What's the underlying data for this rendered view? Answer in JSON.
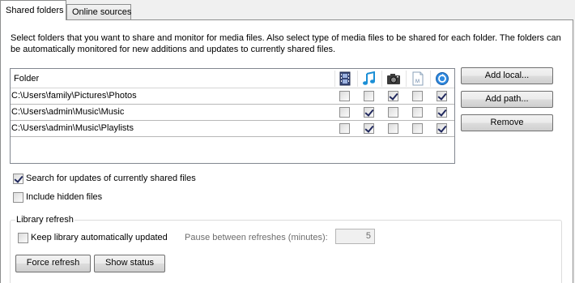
{
  "tabs": [
    {
      "label": "Shared folders",
      "active": true
    },
    {
      "label": "Online sources",
      "active": false
    }
  ],
  "description": "Select folders that you want to share and monitor for media files. Also select type of media files to be shared for each folder. The folders can be automatically monitored for new additions and updates to currently shared files.",
  "table": {
    "column_header": "Folder",
    "media_columns": [
      "video-icon",
      "music-icon",
      "photo-icon",
      "document-icon",
      "playlist-icon"
    ],
    "rows": [
      {
        "path": "C:\\Users\\family\\Pictures\\Photos",
        "checks": [
          false,
          false,
          true,
          false,
          true
        ]
      },
      {
        "path": "C:\\Users\\admin\\Music\\Music",
        "checks": [
          false,
          true,
          false,
          false,
          true
        ]
      },
      {
        "path": "C:\\Users\\admin\\Music\\Playlists",
        "checks": [
          false,
          true,
          false,
          false,
          true
        ]
      }
    ]
  },
  "buttons": {
    "add_local": "Add local...",
    "add_path": "Add path...",
    "remove": "Remove",
    "force_refresh": "Force refresh",
    "show_status": "Show status"
  },
  "options": {
    "search_updates": {
      "label": "Search for updates of currently shared files",
      "checked": true
    },
    "include_hidden": {
      "label": "Include hidden files",
      "checked": false
    }
  },
  "library_refresh": {
    "title": "Library refresh",
    "keep_updated": {
      "label": "Keep library automatically updated",
      "checked": false
    },
    "pause_label": "Pause between refreshes (minutes):",
    "pause_value": "5"
  }
}
